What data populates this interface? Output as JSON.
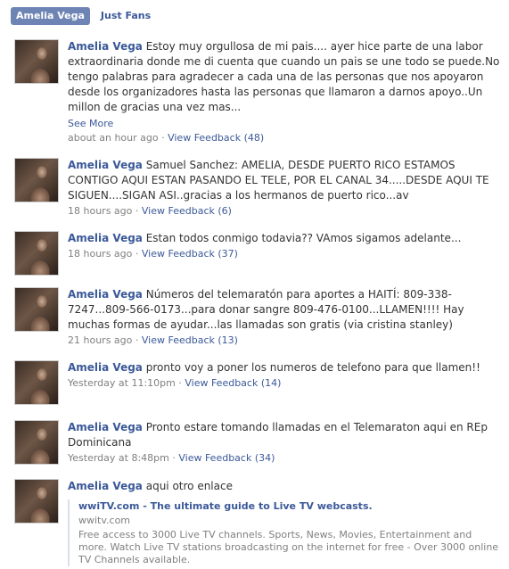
{
  "tabs": [
    {
      "label": "Amelia Vega",
      "active": true
    },
    {
      "label": "Just Fans",
      "active": false
    }
  ],
  "stories": [
    {
      "author": "Amelia Vega",
      "text": "Estoy muy orgullosa de mi pais.... ayer hice parte de una labor extraordinaria donde me di cuenta que cuando un pais se une todo se puede.No tengo palabras para agradecer a cada una de las personas que nos apoyaron desde los organizadores hasta las personas que llamaron a darnos apoyo..Un millon de gracias una vez mas...",
      "see_more": "See More",
      "time": "about an hour ago",
      "feedback": "View Feedback (48)"
    },
    {
      "author": "Amelia Vega",
      "text": "Samuel Sanchez: AMELIA, DESDE PUERTO RICO ESTAMOS CONTIGO AQUI ESTAN PASANDO EL TELE, POR EL CANAL 34.....DESDE AQUI TE SIGUEN....SIGAN ASI..gracias a los hermanos de puerto rico...av",
      "time": "18 hours ago",
      "feedback": "View Feedback (6)"
    },
    {
      "author": "Amelia Vega",
      "text": "Estan todos conmigo todavia?? VAmos sigamos adelante...",
      "time": "18 hours ago",
      "feedback": "View Feedback (37)"
    },
    {
      "author": "Amelia Vega",
      "text": "Números del telemaratón para aportes a HAITÍ: 809-338-7247...809-566-0173...para donar sangre 809-476-0100...LLAMEN!!!! Hay muchas formas de ayudar...las llamadas son gratis (via cristina stanley)",
      "time": "21 hours ago",
      "feedback": "View Feedback (13)"
    },
    {
      "author": "Amelia Vega",
      "text": "pronto voy a poner los numeros de telefono para que llamen!!",
      "time": "Yesterday at 11:10pm",
      "feedback": "View Feedback (14)"
    },
    {
      "author": "Amelia Vega",
      "text": "Pronto estare tomando llamadas en el Telemaraton aqui en REp Dominicana",
      "time": "Yesterday at 8:48pm",
      "feedback": "View Feedback (34)"
    },
    {
      "author": "Amelia Vega",
      "text": "aqui otro enlace",
      "link": {
        "title": "wwiTV.com - The ultimate guide to Live TV webcasts.",
        "domain": "wwitv.com",
        "description": "Free access to 3000 Live TV channels. Sports, News, Movies, Entertainment and more. Watch Live TV stations broadcasting on the internet for free - Over 3000 online TV Channels available."
      }
    }
  ]
}
